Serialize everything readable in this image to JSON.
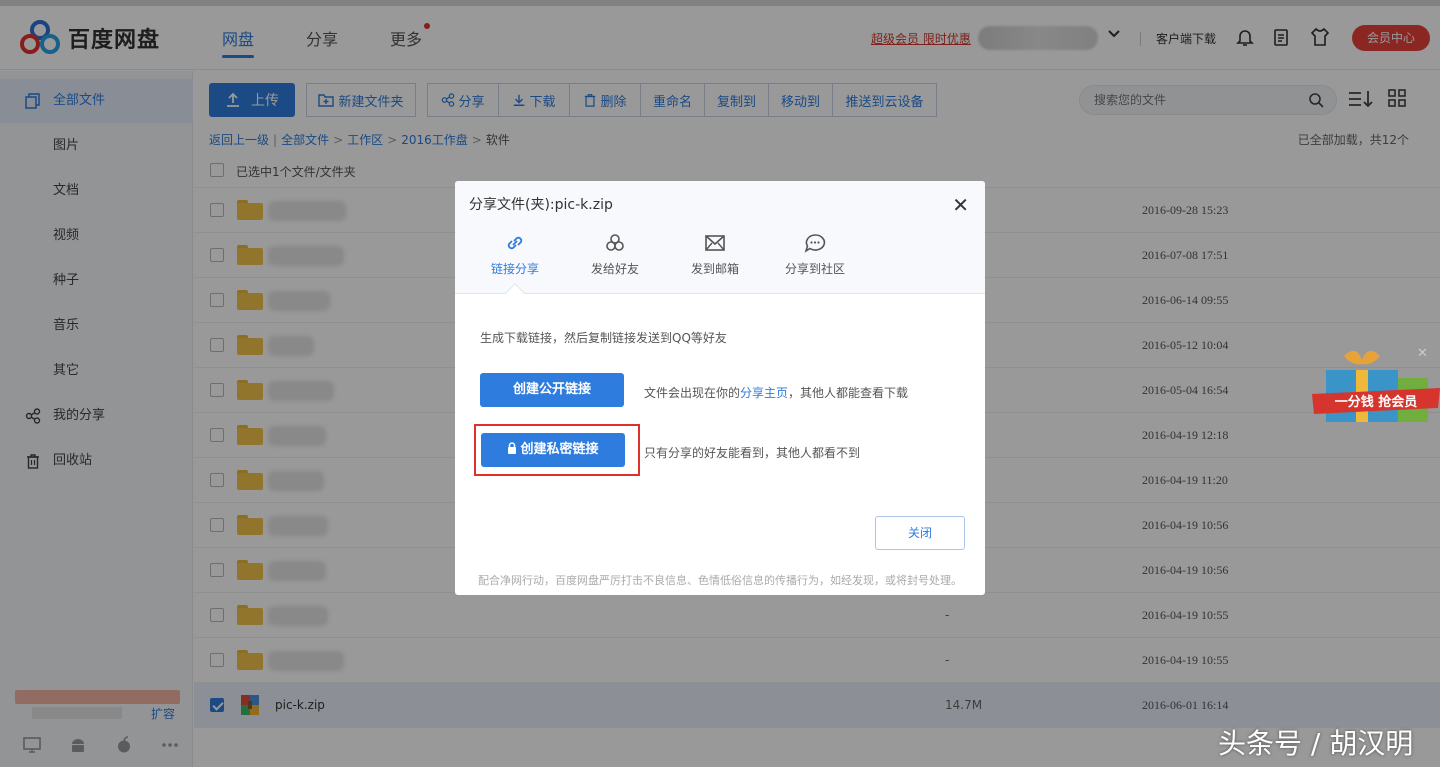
{
  "header": {
    "logo_text": "百度网盘",
    "nav": [
      {
        "label": "网盘",
        "active": true
      },
      {
        "label": "分享",
        "active": false
      },
      {
        "label": "更多",
        "active": false
      }
    ],
    "promo": "超级会员 限时优惠",
    "client_download": "客户端下载",
    "vip_center": "会员中心"
  },
  "sidebar": {
    "items": [
      {
        "label": "全部文件",
        "icon": "files-icon",
        "active": true
      },
      {
        "label": "图片"
      },
      {
        "label": "文档"
      },
      {
        "label": "视频"
      },
      {
        "label": "种子"
      },
      {
        "label": "音乐"
      },
      {
        "label": "其它"
      },
      {
        "label": "我的分享",
        "icon": "share-icon"
      },
      {
        "label": "回收站",
        "icon": "trash-icon"
      }
    ],
    "expand": "扩容"
  },
  "toolbar": {
    "upload": "上传",
    "new_folder": "新建文件夹",
    "share": "分享",
    "download": "下载",
    "delete": "删除",
    "rename": "重命名",
    "copy_to": "复制到",
    "move_to": "移动到",
    "push": "推送到云设备"
  },
  "search": {
    "placeholder": "搜索您的文件"
  },
  "breadcrumb": {
    "back": "返回上一级",
    "all": "全部文件",
    "work": "工作区",
    "year": "2016工作盘",
    "current": "软件"
  },
  "loaded_text": "已全部加载，共12个",
  "selected_text": "已选中1个文件/文件夹",
  "files": [
    {
      "size": "",
      "date": "2016-09-28 15:23"
    },
    {
      "size": "",
      "date": "2016-07-08 17:51"
    },
    {
      "size": "",
      "date": "2016-06-14 09:55"
    },
    {
      "size": "",
      "date": "2016-05-12 10:04"
    },
    {
      "size": "",
      "date": "2016-05-04 16:54"
    },
    {
      "size": "",
      "date": "2016-04-19 12:18"
    },
    {
      "size": "",
      "date": "2016-04-19 11:20"
    },
    {
      "size": "",
      "date": "2016-04-19 10:56"
    },
    {
      "size": "",
      "date": "2016-04-19 10:56"
    },
    {
      "size": "-",
      "date": "2016-04-19 10:55"
    },
    {
      "size": "-",
      "date": "2016-04-19 10:55"
    },
    {
      "name": "pic-k.zip",
      "size": "14.7M",
      "date": "2016-06-01 16:14",
      "selected": true
    }
  ],
  "dialog": {
    "title": "分享文件(夹):pic-k.zip",
    "tabs": [
      {
        "label": "链接分享",
        "active": true
      },
      {
        "label": "发给好友"
      },
      {
        "label": "发到邮箱"
      },
      {
        "label": "分享到社区"
      }
    ],
    "desc": "生成下载链接，然后复制链接发送到QQ等好友",
    "public_btn": "创建公开链接",
    "public_note_pre": "文件会出现在你的",
    "public_note_link": "分享主页",
    "public_note_post": "，其他人都能查看下载",
    "private_btn": "创建私密链接",
    "private_note": "只有分享的好友能看到，其他人都看不到",
    "close_btn": "关闭",
    "footer": "配合净网行动，百度网盘严厉打击不良信息、色情低俗信息的传播行为，如经发现，或将封号处理。"
  },
  "gift_text": "一分钱 抢会员",
  "watermark": "头条号 / 胡汉明",
  "colors": {
    "accent": "#2e7cde",
    "danger": "#e0302c"
  }
}
